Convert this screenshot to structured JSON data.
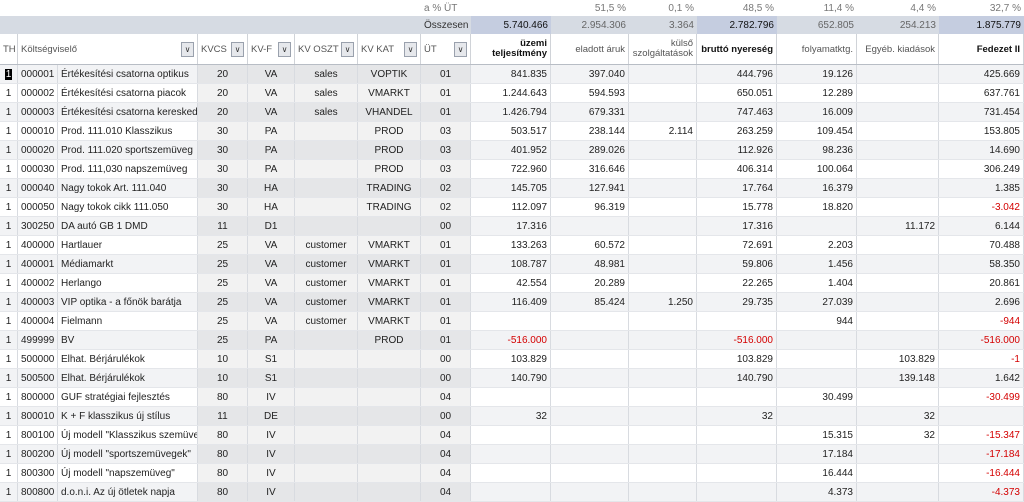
{
  "pct_row": {
    "label": "a % ÜT",
    "eladott": "51,5 %",
    "kulso": "0,1 %",
    "brutto": "48,5 %",
    "folyamat": "11,4 %",
    "egyeb": "4,4 %",
    "fedezet": "32,7 %"
  },
  "total_row": {
    "label": "Összesen",
    "uzemi": "5.740.466",
    "eladott": "2.954.306",
    "kulso": "3.364",
    "brutto": "2.782.796",
    "folyamat": "652.805",
    "egyeb": "254.213",
    "fedezet": "1.875.779"
  },
  "headers": {
    "th": "TH",
    "koltseg": "Költségviselő",
    "kvcs": "KVCS",
    "kvf": "KV-F",
    "kvoszt": "KV OSZT",
    "kvkat": "KV KAT",
    "ut": "ÜT",
    "uzemi": "üzemi teljesítmény",
    "eladott": "eladott áruk",
    "kulso": "külső szolgáltatások",
    "brutto": "bruttó nyereség",
    "folyamat": "folyamatktg.",
    "egyeb": "Egyéb. kiadások",
    "fedezet": "Fedezet II",
    "dropdown_glyph": "∨"
  },
  "rows": [
    {
      "th": "1",
      "id": "000001",
      "name": "Értékesítési csatorna optikus",
      "kvcs": "20",
      "kvf": "VA",
      "oszt": "sales",
      "kat": "VOPTIK",
      "ut": "01",
      "uzemi": "841.835",
      "eladott": "397.040",
      "kulso": "",
      "brutto": "444.796",
      "folyamat": "19.126",
      "egyeb": "",
      "fedezet": "425.669"
    },
    {
      "th": "1",
      "id": "000002",
      "name": "Értékesítési csatorna piacok",
      "kvcs": "20",
      "kvf": "VA",
      "oszt": "sales",
      "kat": "VMARKT",
      "ut": "01",
      "uzemi": "1.244.643",
      "eladott": "594.593",
      "kulso": "",
      "brutto": "650.051",
      "folyamat": "12.289",
      "egyeb": "",
      "fedezet": "637.761"
    },
    {
      "th": "1",
      "id": "000003",
      "name": "Értékesítési csatorna keresked",
      "kvcs": "20",
      "kvf": "VA",
      "oszt": "sales",
      "kat": "VHANDEL",
      "ut": "01",
      "uzemi": "1.426.794",
      "eladott": "679.331",
      "kulso": "",
      "brutto": "747.463",
      "folyamat": "16.009",
      "egyeb": "",
      "fedezet": "731.454"
    },
    {
      "th": "1",
      "id": "000010",
      "name": "Prod. 111.010 Klasszikus",
      "kvcs": "30",
      "kvf": "PA",
      "oszt": "",
      "kat": "PROD",
      "ut": "03",
      "uzemi": "503.517",
      "eladott": "238.144",
      "kulso": "2.114",
      "brutto": "263.259",
      "folyamat": "109.454",
      "egyeb": "",
      "fedezet": "153.805"
    },
    {
      "th": "1",
      "id": "000020",
      "name": "Prod. 111.020 sportszemüveg",
      "kvcs": "30",
      "kvf": "PA",
      "oszt": "",
      "kat": "PROD",
      "ut": "03",
      "uzemi": "401.952",
      "eladott": "289.026",
      "kulso": "",
      "brutto": "112.926",
      "folyamat": "98.236",
      "egyeb": "",
      "fedezet": "14.690"
    },
    {
      "th": "1",
      "id": "000030",
      "name": "Prod. 111,030 napszemüveg",
      "kvcs": "30",
      "kvf": "PA",
      "oszt": "",
      "kat": "PROD",
      "ut": "03",
      "uzemi": "722.960",
      "eladott": "316.646",
      "kulso": "",
      "brutto": "406.314",
      "folyamat": "100.064",
      "egyeb": "",
      "fedezet": "306.249"
    },
    {
      "th": "1",
      "id": "000040",
      "name": "Nagy tokok Art. 111.040",
      "kvcs": "30",
      "kvf": "HA",
      "oszt": "",
      "kat": "TRADING",
      "ut": "02",
      "uzemi": "145.705",
      "eladott": "127.941",
      "kulso": "",
      "brutto": "17.764",
      "folyamat": "16.379",
      "egyeb": "",
      "fedezet": "1.385"
    },
    {
      "th": "1",
      "id": "000050",
      "name": "Nagy tokok cikk 111.050",
      "kvcs": "30",
      "kvf": "HA",
      "oszt": "",
      "kat": "TRADING",
      "ut": "02",
      "uzemi": "112.097",
      "eladott": "96.319",
      "kulso": "",
      "brutto": "15.778",
      "folyamat": "18.820",
      "egyeb": "",
      "fedezet": "-3.042"
    },
    {
      "th": "1",
      "id": "300250",
      "name": "DA autó GB 1 DMD",
      "kvcs": "11",
      "kvf": "D1",
      "oszt": "",
      "kat": "",
      "ut": "00",
      "uzemi": "17.316",
      "eladott": "",
      "kulso": "",
      "brutto": "17.316",
      "folyamat": "",
      "egyeb": "11.172",
      "fedezet": "6.144"
    },
    {
      "th": "1",
      "id": "400000",
      "name": "Hartlauer",
      "kvcs": "25",
      "kvf": "VA",
      "oszt": "customer",
      "kat": "VMARKT",
      "ut": "01",
      "uzemi": "133.263",
      "eladott": "60.572",
      "kulso": "",
      "brutto": "72.691",
      "folyamat": "2.203",
      "egyeb": "",
      "fedezet": "70.488"
    },
    {
      "th": "1",
      "id": "400001",
      "name": "Médiamarkt",
      "kvcs": "25",
      "kvf": "VA",
      "oszt": "customer",
      "kat": "VMARKT",
      "ut": "01",
      "uzemi": "108.787",
      "eladott": "48.981",
      "kulso": "",
      "brutto": "59.806",
      "folyamat": "1.456",
      "egyeb": "",
      "fedezet": "58.350"
    },
    {
      "th": "1",
      "id": "400002",
      "name": "Herlango",
      "kvcs": "25",
      "kvf": "VA",
      "oszt": "customer",
      "kat": "VMARKT",
      "ut": "01",
      "uzemi": "42.554",
      "eladott": "20.289",
      "kulso": "",
      "brutto": "22.265",
      "folyamat": "1.404",
      "egyeb": "",
      "fedezet": "20.861"
    },
    {
      "th": "1",
      "id": "400003",
      "name": "VIP optika - a főnök barátja",
      "kvcs": "25",
      "kvf": "VA",
      "oszt": "customer",
      "kat": "VMARKT",
      "ut": "01",
      "uzemi": "116.409",
      "eladott": "85.424",
      "kulso": "1.250",
      "brutto": "29.735",
      "folyamat": "27.039",
      "egyeb": "",
      "fedezet": "2.696"
    },
    {
      "th": "1",
      "id": "400004",
      "name": "Fielmann",
      "kvcs": "25",
      "kvf": "VA",
      "oszt": "customer",
      "kat": "VMARKT",
      "ut": "01",
      "uzemi": "",
      "eladott": "",
      "kulso": "",
      "brutto": "",
      "folyamat": "944",
      "egyeb": "",
      "fedezet": "-944"
    },
    {
      "th": "1",
      "id": "499999",
      "name": "BV",
      "kvcs": "25",
      "kvf": "PA",
      "oszt": "",
      "kat": "PROD",
      "ut": "01",
      "uzemi": "-516.000",
      "eladott": "",
      "kulso": "",
      "brutto": "-516.000",
      "folyamat": "",
      "egyeb": "",
      "fedezet": "-516.000"
    },
    {
      "th": "1",
      "id": "500000",
      "name": "Elhat. Bérjárulékok",
      "kvcs": "10",
      "kvf": "S1",
      "oszt": "",
      "kat": "",
      "ut": "00",
      "uzemi": "103.829",
      "eladott": "",
      "kulso": "",
      "brutto": "103.829",
      "folyamat": "",
      "egyeb": "103.829",
      "fedezet": "-1"
    },
    {
      "th": "1",
      "id": "500500",
      "name": "Elhat. Bérjárulékok",
      "kvcs": "10",
      "kvf": "S1",
      "oszt": "",
      "kat": "",
      "ut": "00",
      "uzemi": "140.790",
      "eladott": "",
      "kulso": "",
      "brutto": "140.790",
      "folyamat": "",
      "egyeb": "139.148",
      "fedezet": "1.642"
    },
    {
      "th": "1",
      "id": "800000",
      "name": "GUF stratégiai fejlesztés",
      "kvcs": "80",
      "kvf": "IV",
      "oszt": "",
      "kat": "",
      "ut": "04",
      "uzemi": "",
      "eladott": "",
      "kulso": "",
      "brutto": "",
      "folyamat": "30.499",
      "egyeb": "",
      "fedezet": "-30.499"
    },
    {
      "th": "1",
      "id": "800010",
      "name": "K + F klasszikus új stílus",
      "kvcs": "11",
      "kvf": "DE",
      "oszt": "",
      "kat": "",
      "ut": "00",
      "uzemi": "32",
      "eladott": "",
      "kulso": "",
      "brutto": "32",
      "folyamat": "",
      "egyeb": "32",
      "fedezet": ""
    },
    {
      "th": "1",
      "id": "800100",
      "name": "Új modell \"Klasszikus szemüveg",
      "kvcs": "80",
      "kvf": "IV",
      "oszt": "",
      "kat": "",
      "ut": "04",
      "uzemi": "",
      "eladott": "",
      "kulso": "",
      "brutto": "",
      "folyamat": "15.315",
      "egyeb": "32",
      "fedezet": "-15.347"
    },
    {
      "th": "1",
      "id": "800200",
      "name": "Új modell \"sportszemüvegek\"",
      "kvcs": "80",
      "kvf": "IV",
      "oszt": "",
      "kat": "",
      "ut": "04",
      "uzemi": "",
      "eladott": "",
      "kulso": "",
      "brutto": "",
      "folyamat": "17.184",
      "egyeb": "",
      "fedezet": "-17.184"
    },
    {
      "th": "1",
      "id": "800300",
      "name": "Új modell \"napszemüveg\"",
      "kvcs": "80",
      "kvf": "IV",
      "oszt": "",
      "kat": "",
      "ut": "04",
      "uzemi": "",
      "eladott": "",
      "kulso": "",
      "brutto": "",
      "folyamat": "16.444",
      "egyeb": "",
      "fedezet": "-16.444"
    },
    {
      "th": "1",
      "id": "800800",
      "name": "d.o.n.i. Az új ötletek napja",
      "kvcs": "80",
      "kvf": "IV",
      "oszt": "",
      "kat": "",
      "ut": "04",
      "uzemi": "",
      "eladott": "",
      "kulso": "",
      "brutto": "",
      "folyamat": "4.373",
      "egyeb": "",
      "fedezet": "-4.373"
    }
  ]
}
